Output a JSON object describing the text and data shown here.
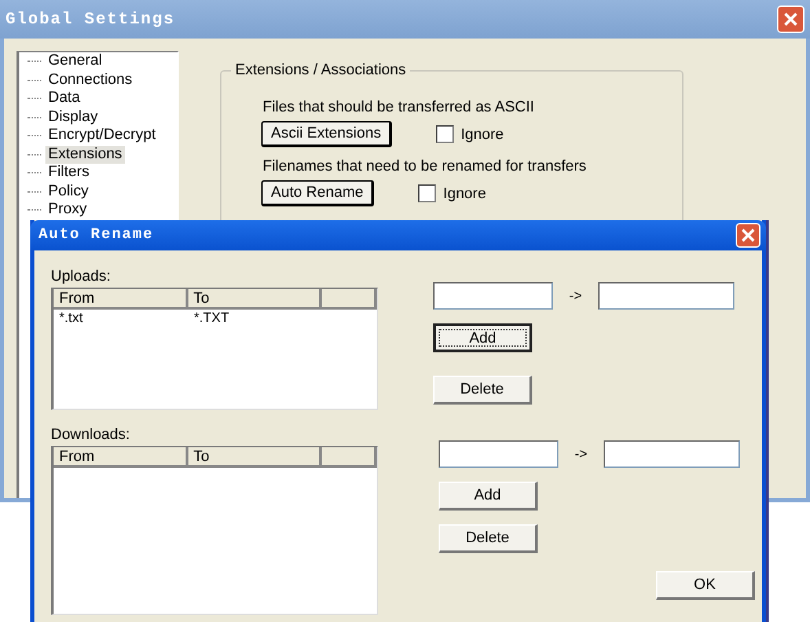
{
  "window": {
    "title": "Global Settings"
  },
  "tree": [
    {
      "label": "General",
      "selected": false
    },
    {
      "label": "Connections",
      "selected": false
    },
    {
      "label": "Data",
      "selected": false
    },
    {
      "label": "Display",
      "selected": false
    },
    {
      "label": "Encrypt/Decrypt",
      "selected": false
    },
    {
      "label": "Extensions",
      "selected": true
    },
    {
      "label": "Filters",
      "selected": false
    },
    {
      "label": "Policy",
      "selected": false
    },
    {
      "label": "Proxy",
      "selected": false
    }
  ],
  "group": {
    "title": "Extensions / Associations",
    "sections": [
      {
        "label": "Files that should be transferred as ASCII",
        "button": "Ascii Extensions",
        "checkbox": {
          "label": "Ignore",
          "checked": false
        }
      },
      {
        "label": "Filenames that need to be renamed for transfers",
        "button": "Auto Rename",
        "checkbox": {
          "label": "Ignore",
          "checked": false
        }
      }
    ]
  },
  "dialog": {
    "title": "Auto Rename",
    "panels": [
      {
        "label": "Uploads:",
        "columns": [
          "From",
          "To"
        ],
        "rows": [
          [
            "*.txt",
            "*.TXT"
          ]
        ],
        "arrow": "->",
        "add": {
          "label": "Add",
          "focused": true
        },
        "delete": "Delete"
      },
      {
        "label": "Downloads:",
        "columns": [
          "From",
          "To"
        ],
        "arrow": "->",
        "add": {
          "label": "Add",
          "focused": false
        },
        "delete": "Delete"
      }
    ],
    "ok": "OK"
  }
}
